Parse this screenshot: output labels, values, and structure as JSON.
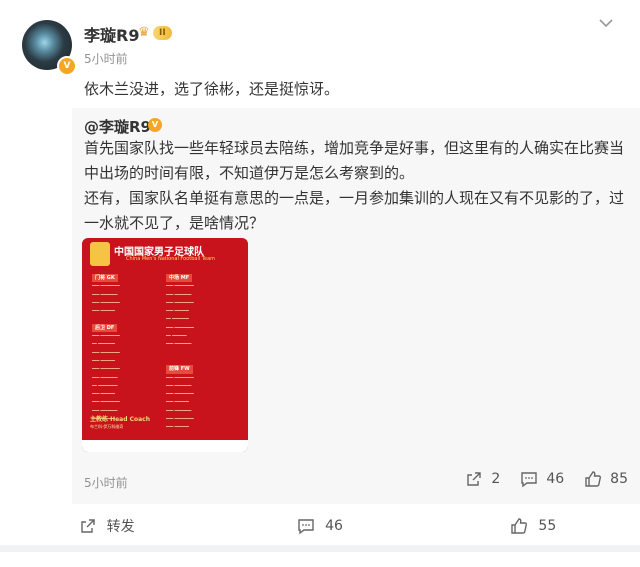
{
  "post": {
    "username": "李璇R9",
    "vip_level": "II",
    "time": "5小时前",
    "text": "依木兰没进，选了徐彬，还是挺惊讶。",
    "avatar_badge": "V"
  },
  "repost": {
    "username": "@李璇R9",
    "text": "首先国家队找一些年轻球员去陪练，增加竞争是好事，但这里有的人确实在比赛当中出场的时间有限，不知道伊万是怎么考察到的。\n还有，国家队名单挺有意思的一点是，一月参加集训的人现在又有不见影的了，过一水就不见了，是啥情况？",
    "time": "5小时前",
    "repost_count": "2",
    "comment_count": "46",
    "like_count": "85",
    "image": {
      "title": "中国国家男子足球队",
      "subtitle": "China Men's National Football Team",
      "gk_label": "门将 GK",
      "df_label": "后卫 DF",
      "mf_label": "中场 MF",
      "fw_label": "前锋 FW",
      "coach_label": "主教练 Head Coach",
      "coach_name": "布兰科·伊万科维奇"
    }
  },
  "footer": {
    "forward_label": "转发",
    "comment_count": "46",
    "like_count": "55"
  },
  "colors": {
    "image_red": "#c8131c",
    "vip_gold": "#f3b93b",
    "badge_orange": "#f5a623"
  }
}
